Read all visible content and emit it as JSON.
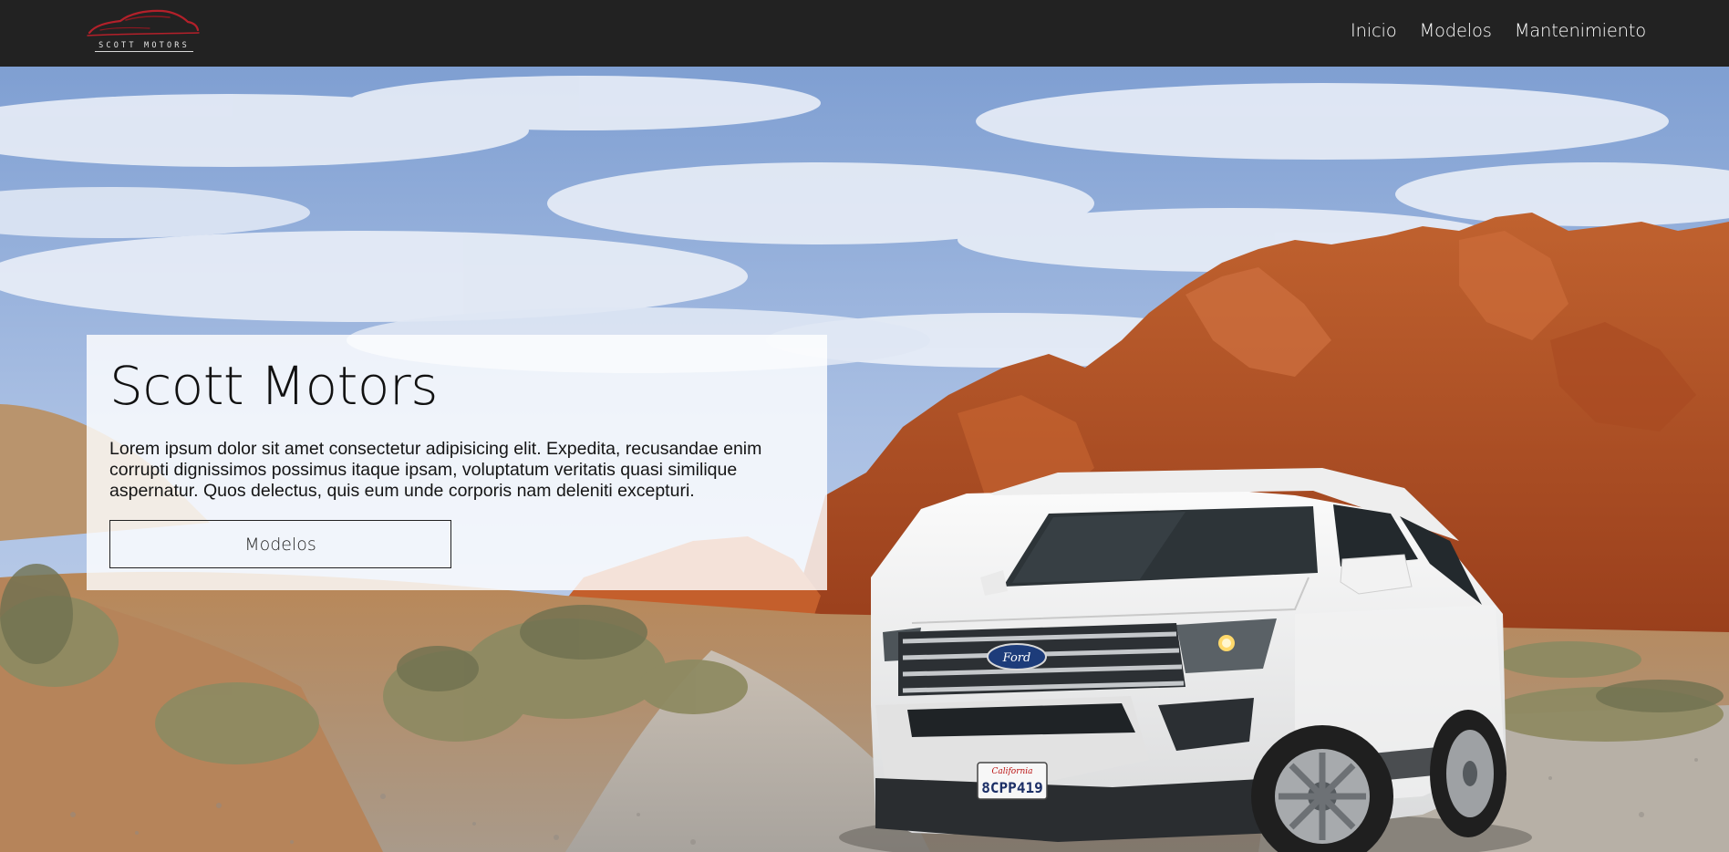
{
  "brand": {
    "logo_text": "SCOTT MOTORS",
    "logo_color": "#b3202a"
  },
  "nav": {
    "items": [
      {
        "label": "Inicio"
      },
      {
        "label": "Modelos"
      },
      {
        "label": "Mantenimiento"
      }
    ]
  },
  "hero": {
    "title": "Scott Motors",
    "text": "Lorem ipsum dolor sit amet consectetur adipisicing elit. Expedita, recusandae enim corrupti dignissimos possimus itaque ipsam, voluptatum veritatis quasi similique aspernatur. Quos delectus, quis eum unde corporis nam deleniti excepturi.",
    "button_label": "Modelos",
    "background_icon": "desert-suv-photo",
    "license_plate": "8CPP419",
    "plate_state": "California",
    "vehicle_badge": "Ford"
  },
  "colors": {
    "navbar": "#222222",
    "sky": "#8aa9d9",
    "rock": "#b9572a",
    "card": "#ffffff"
  }
}
